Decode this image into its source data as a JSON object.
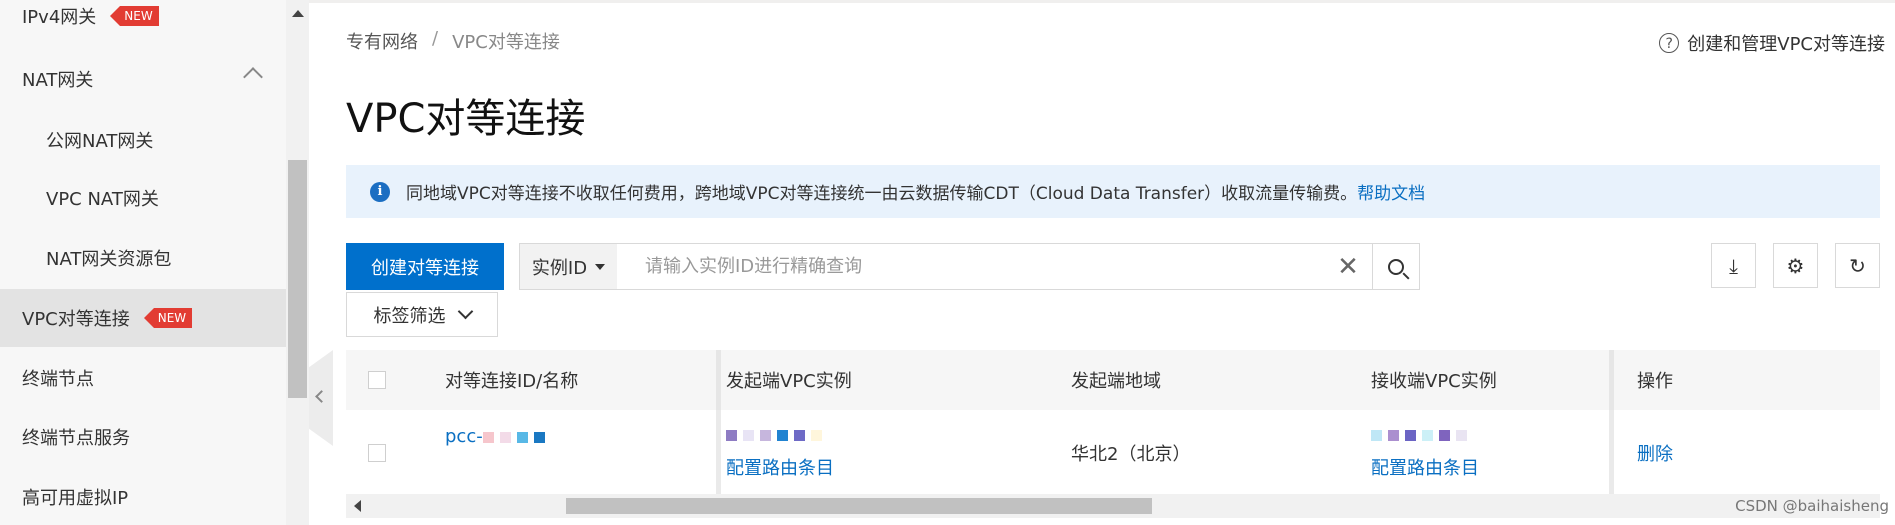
{
  "sidebar": {
    "items": [
      {
        "label": "IPv4网关",
        "badge": "NEW"
      },
      {
        "label": "NAT网关"
      },
      {
        "label": "公网NAT网关"
      },
      {
        "label": "VPC NAT网关"
      },
      {
        "label": "NAT网关资源包"
      },
      {
        "label": "VPC对等连接",
        "badge": "NEW"
      },
      {
        "label": "终端节点"
      },
      {
        "label": "终端节点服务"
      },
      {
        "label": "高可用虚拟IP"
      }
    ]
  },
  "breadcrumb": {
    "root": "专有网络",
    "separator": "/",
    "current": "VPC对等连接"
  },
  "help": {
    "label": "创建和管理VPC对等连接",
    "icon": "?"
  },
  "page": {
    "title": "VPC对等连接"
  },
  "notice": {
    "text": "同地域VPC对等连接不收取任何费用，跨地域VPC对等连接统一由云数据传输CDT（Cloud Data Transfer）收取流量传输费。",
    "link": "帮助文档"
  },
  "toolbar": {
    "create_label": "创建对等连接",
    "select_value": "实例ID",
    "search_placeholder": "请输入实例ID进行精确查询",
    "clear_symbol": "✕",
    "tag_filter_label": "标签筛选",
    "download_symbol": "⤓",
    "settings_symbol": "⚙",
    "refresh_symbol": "↻"
  },
  "table": {
    "columns": [
      "对等连接ID/名称",
      "发起端VPC实例",
      "发起端地域",
      "接收端VPC实例",
      "操作"
    ],
    "rows": [
      {
        "id_prefix": "pcc-",
        "origin_route": "配置路由条目",
        "origin_region": "华北2（北京）",
        "receiver_route": "配置路由条目",
        "action": "删除"
      }
    ]
  },
  "watermark": "CSDN @baihaisheng"
}
